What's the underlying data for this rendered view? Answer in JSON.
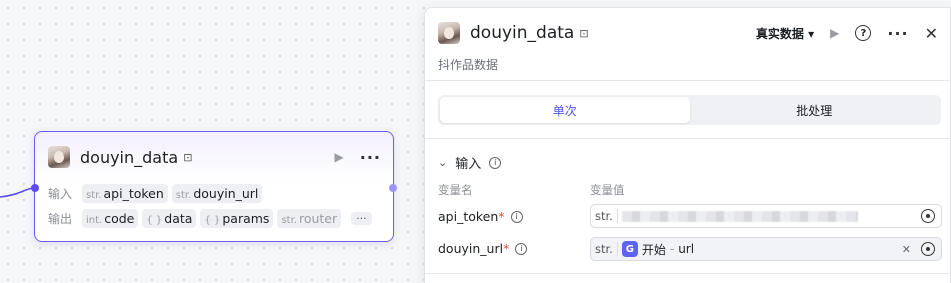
{
  "node": {
    "title": "douyin_data",
    "input_label": "输入",
    "output_label": "输出",
    "inputs": [
      {
        "type": "str.",
        "name": "api_token"
      },
      {
        "type": "str.",
        "name": "douyin_url"
      }
    ],
    "outputs": [
      {
        "type": "int.",
        "name": "code"
      },
      {
        "type": "{ }",
        "name": "data"
      },
      {
        "type": "{ }",
        "name": "params"
      },
      {
        "type": "str.",
        "name": "router"
      }
    ],
    "more": "···"
  },
  "panel": {
    "title": "douyin_data",
    "description": "抖作品数据",
    "data_mode": "真实数据",
    "tabs": [
      "单次",
      "批处理"
    ],
    "section_title": "输入",
    "col_name": "变量名",
    "col_value": "变量值",
    "params": [
      {
        "name": "api_token",
        "required": "*",
        "type": "str."
      },
      {
        "name": "douyin_url",
        "required": "*",
        "type": "str.",
        "ref_source": "开始",
        "ref_sep": "-",
        "ref_var": "url"
      }
    ]
  },
  "icons": {
    "play": "play-icon",
    "more": "more-icon",
    "help": "help-icon",
    "close": "close-icon",
    "chevron": "chevron-down-icon",
    "info": "info-icon",
    "target": "target-icon",
    "plugin": "plugin-icon"
  },
  "colors": {
    "accent": "#4d53e8",
    "node_border": "#6b5cf6",
    "required": "#e0474b"
  }
}
